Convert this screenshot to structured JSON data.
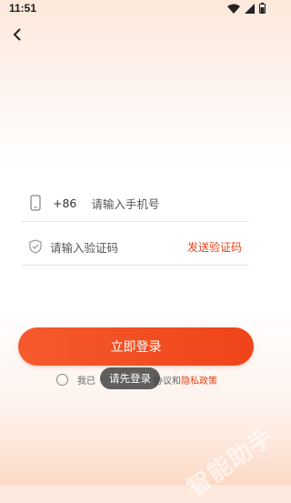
{
  "status_bar": {
    "time": "11:51"
  },
  "login": {
    "country_code": "+86",
    "phone_placeholder": "请输入手机号",
    "code_placeholder": "请输入验证码",
    "send_code_label": "发送验证码",
    "submit_label": "立即登录"
  },
  "agreement": {
    "prefix": "我已",
    "middle": "协议和",
    "policy_link": "隐私政策"
  },
  "toast": {
    "text": "请先登录"
  },
  "watermark": {
    "text": "智能助手"
  },
  "colors": {
    "accent": "#f0441a",
    "link": "#e0461d"
  }
}
